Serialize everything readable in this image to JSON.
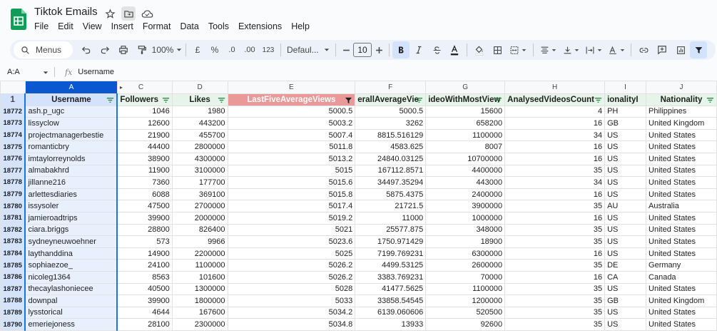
{
  "app": {
    "title": "Tiktok Emails",
    "menu": [
      "File",
      "Edit",
      "View",
      "Insert",
      "Format",
      "Data",
      "Tools",
      "Extensions",
      "Help"
    ]
  },
  "toolbar": {
    "search_label": "Menus",
    "zoom": "100%",
    "currency": "£",
    "percent": "%",
    "dec_decrease": ".0",
    "dec_increase": ".00",
    "number_format": "123",
    "font": "Defaul...",
    "font_size": "10"
  },
  "formula": {
    "cell_ref": "A:A",
    "fx": "fx",
    "content": "Username"
  },
  "columns": [
    "A",
    "C",
    "D",
    "E",
    "F",
    "G",
    "H",
    "I",
    "J"
  ],
  "header_row_number": "1",
  "headers": [
    "Username",
    "Followers",
    "Likes",
    "LastFiveAverageViews",
    "erallAverageVie",
    "ideoWithMostView",
    "AnalysedVideosCount",
    "ionalityI",
    "Nationality"
  ],
  "rows": [
    {
      "n": "18772",
      "c": [
        "ash.p_ugc",
        "1046",
        "1980",
        "5000.5",
        "5000.5",
        "15600",
        "4",
        "PH",
        "Philippines"
      ]
    },
    {
      "n": "18773",
      "c": [
        "lissyclow",
        "12600",
        "443200",
        "5003.2",
        "3262",
        "658200",
        "16",
        "GB",
        "United Kingdom"
      ]
    },
    {
      "n": "18774",
      "c": [
        "projectmanagerbestie",
        "21900",
        "455700",
        "5007.4",
        "8815.516129",
        "1100000",
        "34",
        "US",
        "United States"
      ]
    },
    {
      "n": "18775",
      "c": [
        "romanticbry",
        "44400",
        "2800000",
        "5011.8",
        "4583.625",
        "8007",
        "16",
        "US",
        "United States"
      ]
    },
    {
      "n": "18776",
      "c": [
        "imtaylorreynolds",
        "38900",
        "4300000",
        "5013.2",
        "24840.03125",
        "10700000",
        "16",
        "US",
        "United States"
      ]
    },
    {
      "n": "18777",
      "c": [
        "almabakhrd",
        "11900",
        "3100000",
        "5015",
        "167112.8571",
        "4400000",
        "35",
        "US",
        "United States"
      ]
    },
    {
      "n": "18778",
      "c": [
        "jillanne216",
        "7360",
        "177700",
        "5015.6",
        "34497.35294",
        "443000",
        "34",
        "US",
        "United States"
      ]
    },
    {
      "n": "18779",
      "c": [
        "arlettesdiaries",
        "6088",
        "369100",
        "5015.8",
        "5875.4375",
        "2400000",
        "16",
        "US",
        "United States"
      ]
    },
    {
      "n": "18780",
      "c": [
        "issysoler",
        "47500",
        "2700000",
        "5017.4",
        "21721.5",
        "3900000",
        "35",
        "AU",
        "Australia"
      ]
    },
    {
      "n": "18781",
      "c": [
        "jamieroadtrips",
        "39900",
        "2000000",
        "5019.2",
        "11000",
        "1000000",
        "16",
        "US",
        "United States"
      ]
    },
    {
      "n": "18782",
      "c": [
        "ciara.briggs",
        "28800",
        "826400",
        "5021",
        "25577.875",
        "348000",
        "35",
        "US",
        "United States"
      ]
    },
    {
      "n": "18783",
      "c": [
        "sydneyneuwoehner",
        "573",
        "9966",
        "5023.6",
        "1750.971429",
        "18900",
        "35",
        "US",
        "United States"
      ]
    },
    {
      "n": "18784",
      "c": [
        "laythanddina",
        "14900",
        "2200000",
        "5025",
        "7199.769231",
        "6300000",
        "16",
        "US",
        "United States"
      ]
    },
    {
      "n": "18785",
      "c": [
        "sophiaezoe_",
        "24100",
        "1100000",
        "5026.2",
        "4499.53125",
        "2600000",
        "35",
        "DE",
        "Germany"
      ]
    },
    {
      "n": "18786",
      "c": [
        "nicoleg1364",
        "8563",
        "101600",
        "5026.2",
        "3383.769231",
        "70000",
        "16",
        "CA",
        "Canada"
      ]
    },
    {
      "n": "18787",
      "c": [
        "thecaylashoniecee",
        "40500",
        "1300000",
        "5028",
        "41477.5625",
        "1100000",
        "35",
        "US",
        "United States"
      ]
    },
    {
      "n": "18788",
      "c": [
        "downpal",
        "39900",
        "1800000",
        "5033",
        "33858.54545",
        "1200000",
        "35",
        "GB",
        "United Kingdom"
      ]
    },
    {
      "n": "18789",
      "c": [
        "lysstorical",
        "4644",
        "167600",
        "5034.2",
        "6139.060606",
        "520500",
        "35",
        "US",
        "United States"
      ]
    },
    {
      "n": "18790",
      "c": [
        "emeriejoness",
        "28100",
        "2300000",
        "5034.8",
        "13933",
        "92600",
        "35",
        "US",
        "United States"
      ]
    }
  ],
  "colors": {
    "accent": "#1a73e8",
    "filter_header": "#ea9999",
    "header_bg": "#e6f4ea",
    "sheets_green": "#0f9d58"
  },
  "icons": [
    "star-icon",
    "move-folder-icon",
    "cloud-status-icon",
    "search-icon",
    "undo-icon",
    "redo-icon",
    "print-icon",
    "paint-format-icon",
    "bold-icon",
    "italic-icon",
    "strikethrough-icon",
    "text-color-icon",
    "fill-color-icon",
    "borders-icon",
    "merge-icon",
    "align-icon",
    "valign-icon",
    "wrap-icon",
    "rotate-icon",
    "link-icon",
    "comment-icon",
    "chart-icon",
    "filter-icon"
  ]
}
